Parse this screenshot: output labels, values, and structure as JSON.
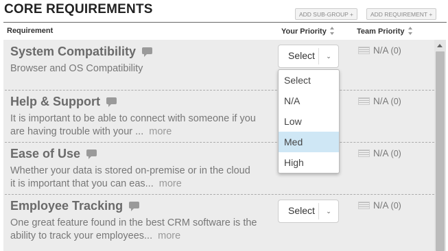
{
  "header": {
    "title": "CORE REQUIREMENTS",
    "add_subgroup_label": "ADD SUB-GROUP +",
    "add_requirement_label": "ADD REQUIREMENT +"
  },
  "columns": {
    "requirement": "Requirement",
    "your_priority": "Your Priority",
    "team_priority": "Team Priority"
  },
  "rows": [
    {
      "title": "System Compatibility",
      "desc_line1": "Browser and OS Compatibility",
      "desc_line2": "",
      "more": "",
      "priority": "Select",
      "team_value": "N/A",
      "team_count": "(0)"
    },
    {
      "title": "Help & Support",
      "desc_line1": "It is important to be able to connect with someone if you",
      "desc_line2": "are having trouble with your ...",
      "more": "more",
      "priority": "",
      "team_value": "N/A",
      "team_count": "(0)"
    },
    {
      "title": "Ease of Use",
      "desc_line1": "Whether your data is stored on-premise or in the cloud",
      "desc_line2": "it is important that you can eas...",
      "more": "more",
      "priority": "",
      "team_value": "N/A",
      "team_count": "(0)"
    },
    {
      "title": "Employee Tracking",
      "desc_line1": "One great feature found in the best CRM software is the",
      "desc_line2": "ability to track your employees...",
      "more": "more",
      "priority": "Select",
      "team_value": "N/A",
      "team_count": "(0)"
    }
  ],
  "dropdown": {
    "options": [
      "Select",
      "N/A",
      "Low",
      "Med",
      "High"
    ],
    "highlighted": "Med"
  },
  "colors": {
    "row_background": "#ececec",
    "highlight": "#cfe7f5"
  }
}
